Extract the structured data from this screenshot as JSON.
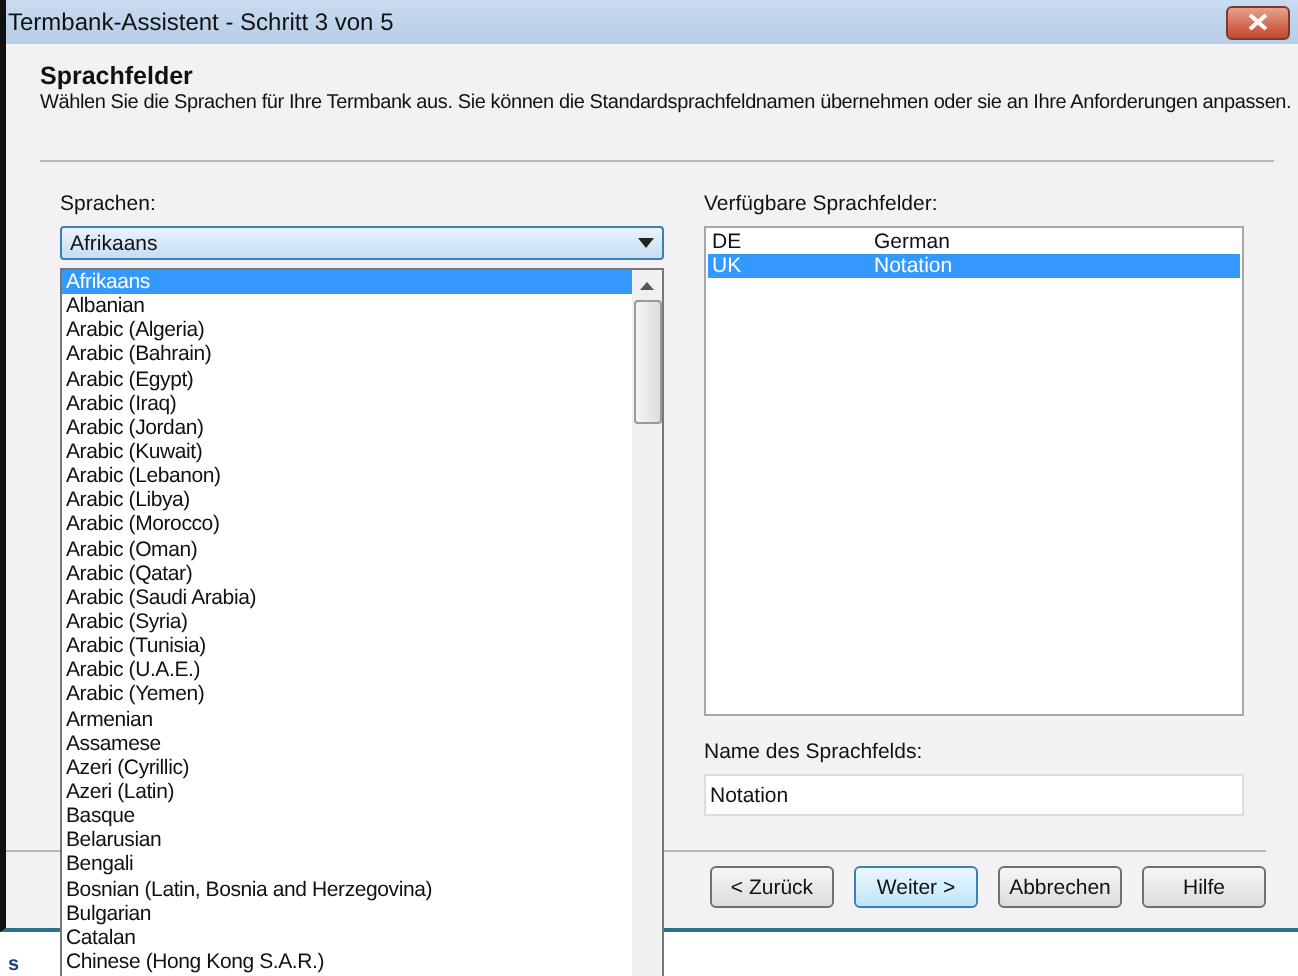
{
  "window": {
    "title": "Termbank-Assistent - Schritt 3 von 5"
  },
  "header": {
    "title": "Sprachfelder",
    "description": "Wählen Sie die Sprachen für Ihre Termbank aus. Sie können die Standardsprachfeldnamen übernehmen oder sie an Ihre Anforderungen anpassen."
  },
  "languages": {
    "label": "Sprachen:",
    "value": "Afrikaans",
    "expanded": true,
    "options": [
      {
        "label": "Afrikaans",
        "selected": true
      },
      {
        "label": "Albanian",
        "selected": false
      },
      {
        "label": "Arabic (Algeria)",
        "selected": false
      },
      {
        "label": "Arabic (Bahrain)",
        "selected": false
      },
      {
        "label": "Arabic (Egypt)",
        "selected": false
      },
      {
        "label": "Arabic (Iraq)",
        "selected": false
      },
      {
        "label": "Arabic (Jordan)",
        "selected": false
      },
      {
        "label": "Arabic (Kuwait)",
        "selected": false
      },
      {
        "label": "Arabic (Lebanon)",
        "selected": false
      },
      {
        "label": "Arabic (Libya)",
        "selected": false
      },
      {
        "label": "Arabic (Morocco)",
        "selected": false
      },
      {
        "label": "Arabic (Oman)",
        "selected": false
      },
      {
        "label": "Arabic (Qatar)",
        "selected": false
      },
      {
        "label": "Arabic (Saudi Arabia)",
        "selected": false
      },
      {
        "label": "Arabic (Syria)",
        "selected": false
      },
      {
        "label": "Arabic (Tunisia)",
        "selected": false
      },
      {
        "label": "Arabic (U.A.E.)",
        "selected": false
      },
      {
        "label": "Arabic (Yemen)",
        "selected": false
      },
      {
        "label": "Armenian",
        "selected": false
      },
      {
        "label": "Assamese",
        "selected": false
      },
      {
        "label": "Azeri (Cyrillic)",
        "selected": false
      },
      {
        "label": "Azeri (Latin)",
        "selected": false
      },
      {
        "label": "Basque",
        "selected": false
      },
      {
        "label": "Belarusian",
        "selected": false
      },
      {
        "label": "Bengali",
        "selected": false
      },
      {
        "label": "Bosnian (Latin, Bosnia and Herzegovina)",
        "selected": false
      },
      {
        "label": "Bulgarian",
        "selected": false
      },
      {
        "label": "Catalan",
        "selected": false
      },
      {
        "label": "Chinese (Hong Kong S.A.R.)",
        "selected": false
      }
    ]
  },
  "fields": {
    "label": "Verfügbare Sprachfelder:",
    "rows": [
      {
        "code": "DE",
        "name": "German",
        "selected": false
      },
      {
        "code": "UK",
        "name": "Notation",
        "selected": true
      }
    ]
  },
  "name_field": {
    "label": "Name des Sprachfelds:",
    "value": "Notation"
  },
  "buttons": [
    {
      "label": "< Zurück",
      "default": false
    },
    {
      "label": "Weiter >",
      "default": true
    },
    {
      "label": "Abbrechen",
      "default": false
    },
    {
      "label": "Hilfe",
      "default": false
    }
  ],
  "background": {
    "text": "s"
  }
}
